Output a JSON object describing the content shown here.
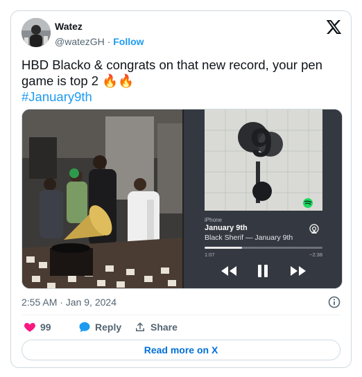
{
  "user": {
    "name": "Watez",
    "handle": "@watezGH",
    "separator": "·",
    "follow": "Follow"
  },
  "tweet": {
    "text": "HBD Blacko & congrats on that new record, your pen game is top 2",
    "emoji": "🔥🔥",
    "hashtag": "#January9th"
  },
  "media": {
    "player": {
      "device": "iPhone",
      "title": "January 9th",
      "artist_line": "Black Sherif — January 9th",
      "elapsed": "1:07",
      "remaining": "−2:38",
      "progress": 0.32,
      "album_art_text": "9"
    }
  },
  "meta": {
    "timestamp": "2:55 AM · Jan 9, 2024"
  },
  "actions": {
    "likes": "99",
    "reply": "Reply",
    "share": "Share"
  },
  "read_more": "Read more on X",
  "colors": {
    "accent": "#1d9bf0",
    "like": "#f91880",
    "link": "#006fd6"
  },
  "icons": [
    "x-logo-icon",
    "heart-icon",
    "reply-bubble-icon",
    "share-icon",
    "info-icon",
    "spotify-icon",
    "airplay-icon",
    "rewind-icon",
    "pause-icon",
    "fast-forward-icon"
  ]
}
